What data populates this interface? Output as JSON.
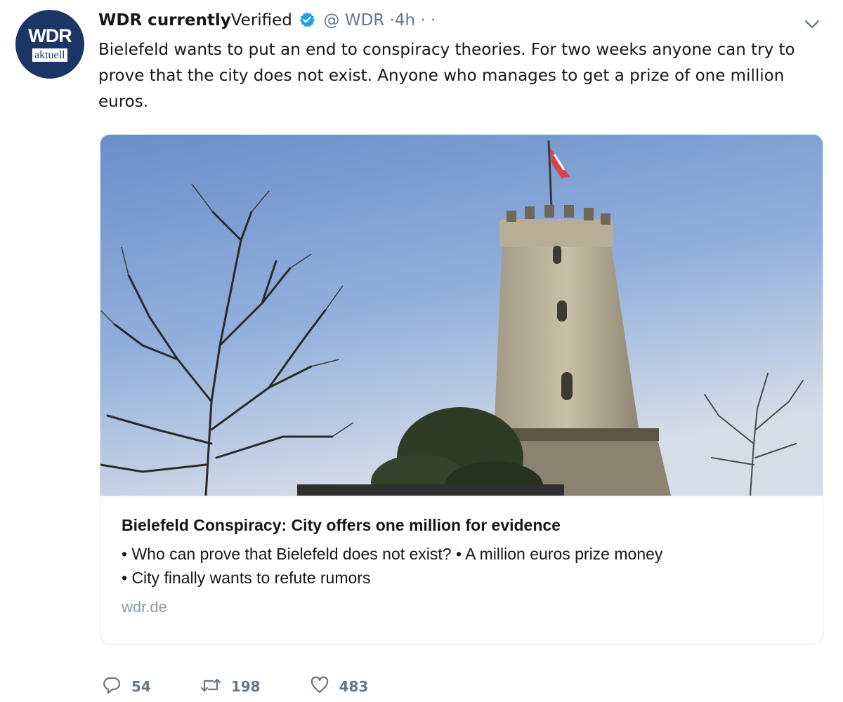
{
  "avatar": {
    "line1": "WDR",
    "line2": "aktuell"
  },
  "tweet": {
    "display_name": "WDR currently",
    "verified_label": "Verified",
    "handle": "@ WDR",
    "time": "·4h",
    "more": "· ·",
    "text": "Bielefeld wants to put an end to conspiracy theories. For two weeks anyone can try to prove that the city does not exist. Anyone who manages to get a prize of one million euros."
  },
  "card": {
    "title": "Bielefeld Conspiracy: City offers one million for evidence",
    "description_line1": "• Who can prove that Bielefeld does not exist? • A million euros prize money",
    "description_line2": "• City finally wants to refute rumors",
    "domain": "wdr.de"
  },
  "actions": {
    "replies": "54",
    "retweets": "198",
    "likes": "483"
  },
  "icons": {
    "verified": "verified-badge-icon",
    "caret": "chevron-down-icon",
    "reply": "reply-icon",
    "retweet": "retweet-icon",
    "like": "heart-icon"
  },
  "colors": {
    "verified": "#1da1f2",
    "secondary_text": "#657786",
    "avatar_bg": "#1c3567"
  }
}
